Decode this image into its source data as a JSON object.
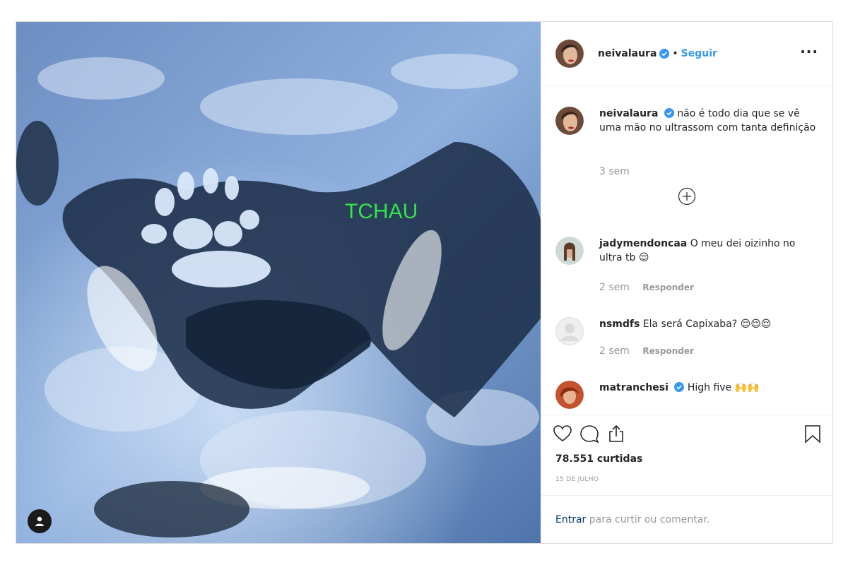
{
  "post": {
    "author": "neivalaura",
    "follow_label": "Seguir",
    "separator": "•",
    "more_label": "···",
    "overlay_text": "TCHAU",
    "overlay_color": "#35e24a"
  },
  "comments": [
    {
      "user": "neivalaura",
      "text": "não é todo dia que se vê uma mão no ultrassom com tanta definição",
      "time": "3 sem",
      "verified": true
    },
    {
      "user": "jadymendoncaa",
      "text": "O meu dei oizinho no ultra tb 😌",
      "time": "2 sem",
      "reply": "Responder"
    },
    {
      "user": "nsmdfs",
      "text": "Ela será Capixaba? 😌😌😌",
      "time": "2 sem",
      "reply": "Responder"
    },
    {
      "user": "matranchesi",
      "text": "High five 🙌🙌",
      "verified": true
    }
  ],
  "footer": {
    "likes": "78.551 curtidas",
    "date": "15 DE JULHO",
    "login_link": "Entrar",
    "login_text": " para curtir ou comentar."
  },
  "colors": {
    "link_blue": "#3897f0",
    "verified_blue": "#3897f0",
    "muted": "#999999",
    "text": "#262626"
  },
  "icons": [
    "user-tag-icon",
    "verified-icon",
    "more-icon",
    "load-more-icon",
    "heart-icon",
    "comment-icon",
    "share-icon",
    "bookmark-icon"
  ]
}
